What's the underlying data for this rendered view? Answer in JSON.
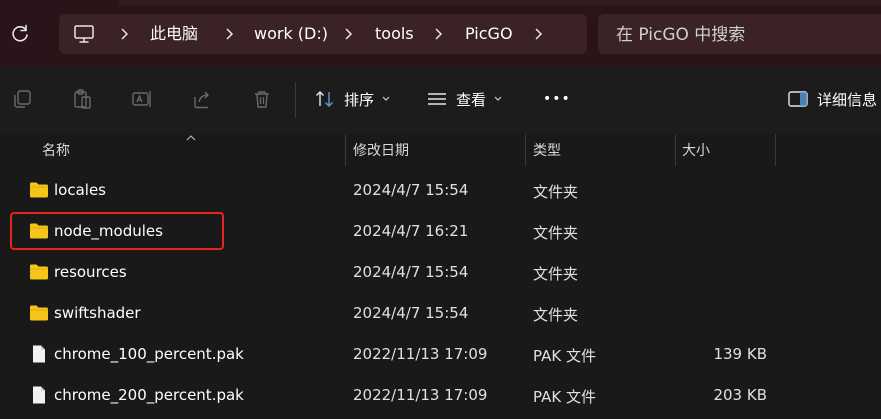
{
  "address_bar": {
    "breadcrumb": [
      "此电脑",
      "work (D:)",
      "tools",
      "PicGO"
    ]
  },
  "search": {
    "placeholder": "在 PicGO 中搜索"
  },
  "toolbar": {
    "sort_label": "排序",
    "view_label": "查看",
    "more_label": "•••",
    "details_label": "详细信息"
  },
  "columns": {
    "name": "名称",
    "modified": "修改日期",
    "type": "类型",
    "size": "大小"
  },
  "files": [
    {
      "name": "locales",
      "modified": "2024/4/7 15:54",
      "type": "文件夹",
      "size": "",
      "icon": "folder-icon"
    },
    {
      "name": "node_modules",
      "modified": "2024/4/7 16:21",
      "type": "文件夹",
      "size": "",
      "icon": "folder-icon",
      "highlighted": true
    },
    {
      "name": "resources",
      "modified": "2024/4/7 15:54",
      "type": "文件夹",
      "size": "",
      "icon": "folder-icon"
    },
    {
      "name": "swiftshader",
      "modified": "2024/4/7 15:54",
      "type": "文件夹",
      "size": "",
      "icon": "folder-icon"
    },
    {
      "name": "chrome_100_percent.pak",
      "modified": "2022/11/13 17:09",
      "type": "PAK 文件",
      "size": "139 KB",
      "icon": "file-icon"
    },
    {
      "name": "chrome_200_percent.pak",
      "modified": "2022/11/13 17:09",
      "type": "PAK 文件",
      "size": "203 KB",
      "icon": "file-icon"
    }
  ],
  "colors": {
    "highlight": "#e8231d",
    "folder": "#f5c518",
    "titlebar": "#2a1419"
  }
}
